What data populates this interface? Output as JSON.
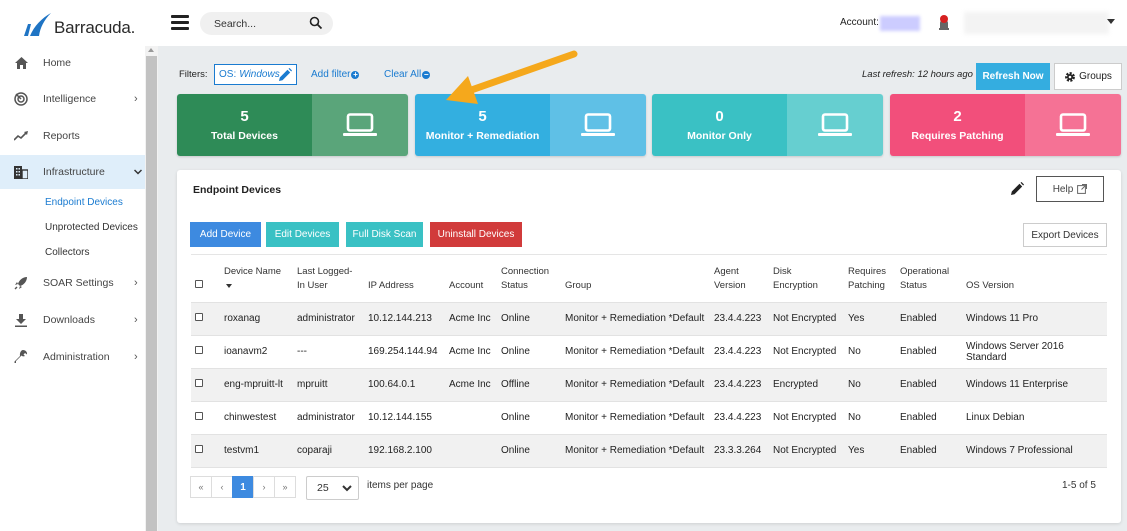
{
  "brand": {
    "name": "Barracuda."
  },
  "topbar": {
    "search_placeholder": "Search...",
    "account_label": "Account:"
  },
  "sidebar": {
    "items": [
      {
        "label": "Home",
        "icon": "home-icon"
      },
      {
        "label": "Intelligence",
        "icon": "radar-icon",
        "chevron": ">"
      },
      {
        "label": "Reports",
        "icon": "trend-icon"
      },
      {
        "label": "Infrastructure",
        "icon": "building-icon",
        "chevron": "v",
        "active": true
      },
      {
        "label": "SOAR Settings",
        "icon": "rocket-icon",
        "chevron": ">"
      },
      {
        "label": "Downloads",
        "icon": "download-icon",
        "chevron": ">"
      },
      {
        "label": "Administration",
        "icon": "wrench-icon",
        "chevron": ">"
      }
    ],
    "subitems": [
      {
        "label": "Endpoint Devices",
        "active": true
      },
      {
        "label": "Unprotected Devices"
      },
      {
        "label": "Collectors"
      }
    ]
  },
  "filters": {
    "label": "Filters:",
    "chip_key": "OS:",
    "chip_value": "Windows",
    "add_filter": "Add filter",
    "clear_all": "Clear All",
    "last_refresh": "Last refresh: 12 hours ago",
    "refresh_now": "Refresh Now",
    "groups": "Groups"
  },
  "cards": [
    {
      "value": "5",
      "label": "Total Devices",
      "color": "#2e8b57",
      "color_light": "#5aa57a"
    },
    {
      "value": "5",
      "label": "Monitor + Remediation",
      "color": "#33afe0",
      "color_light": "#5fc0e6"
    },
    {
      "value": "0",
      "label": "Monitor Only",
      "color": "#3ac1c4",
      "color_light": "#66cfd0"
    },
    {
      "value": "2",
      "label": "Requires Patching",
      "color": "#f24f7b",
      "color_light": "#f57295"
    }
  ],
  "panel": {
    "title": "Endpoint Devices",
    "help": "Help",
    "actions": [
      {
        "label": "Add Device",
        "color": "#3d8ae0"
      },
      {
        "label": "Edit Devices",
        "color": "#3ac1c4"
      },
      {
        "label": "Full Disk Scan",
        "color": "#3ac1c4"
      },
      {
        "label": "Uninstall Devices",
        "color": "#d13b3b"
      }
    ],
    "export": "Export Devices"
  },
  "table": {
    "headers": [
      "Device Name",
      "Last Logged-In User",
      "IP Address",
      "Account",
      "Connection Status",
      "Group",
      "Agent Version",
      "Disk Encryption",
      "Requires Patching",
      "Operational Status",
      "OS Version"
    ],
    "header_lines": [
      [
        "Device Name",
        ""
      ],
      [
        "Last Logged-",
        "In User"
      ],
      [
        "",
        "IP Address"
      ],
      [
        "",
        "Account"
      ],
      [
        "Connection",
        "Status"
      ],
      [
        "",
        "Group"
      ],
      [
        "Agent",
        "Version"
      ],
      [
        "Disk",
        "Encryption"
      ],
      [
        "Requires",
        "Patching"
      ],
      [
        "Operational",
        "Status"
      ],
      [
        "",
        "OS Version"
      ]
    ],
    "rows": [
      [
        "roxanag",
        "administrator",
        "10.12.144.213",
        "Acme Inc",
        "Online",
        "Monitor + Remediation *Default",
        "23.4.4.223",
        "Not Encrypted",
        "Yes",
        "Enabled",
        "Windows 11 Pro"
      ],
      [
        "ioanavm2",
        "---",
        "169.254.144.94",
        "Acme Inc",
        "Online",
        "Monitor + Remediation *Default",
        "23.4.4.223",
        "Not Encrypted",
        "No",
        "Enabled",
        "Windows Server 2016 Standard"
      ],
      [
        "eng-mpruitt-lt",
        "mpruitt",
        "100.64.0.1",
        "Acme Inc",
        "Offline",
        "Monitor + Remediation *Default",
        "23.4.4.223",
        "Encrypted",
        "No",
        "Enabled",
        "Windows 11 Enterprise"
      ],
      [
        "chinwestest",
        "administrator",
        "10.12.144.155",
        "",
        "Online",
        "Monitor + Remediation *Default",
        "23.4.4.223",
        "Not Encrypted",
        "No",
        "Enabled",
        "Linux Debian"
      ],
      [
        "testvm1",
        "coparaji",
        "192.168.2.100",
        "",
        "Online",
        "Monitor + Remediation *Default",
        "23.3.3.264",
        "Not Encrypted",
        "Yes",
        "Enabled",
        "Windows 7 Professional"
      ]
    ]
  },
  "pagination": {
    "first": "«",
    "prev": "‹",
    "current": "1",
    "next": "›",
    "last": "»",
    "per_page": "25",
    "per_page_label": "items per page",
    "range": "1-5 of 5"
  }
}
